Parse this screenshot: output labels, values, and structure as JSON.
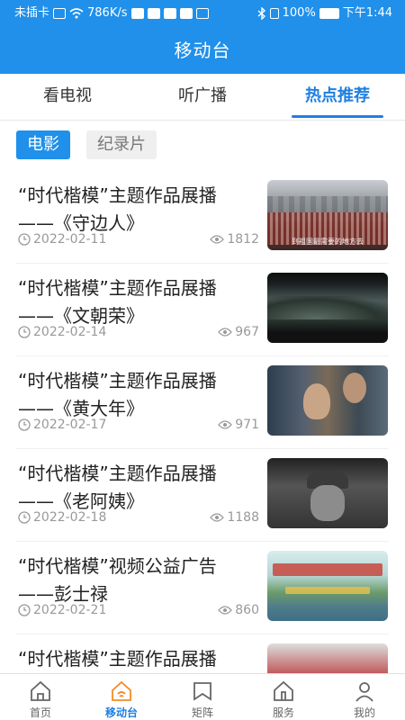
{
  "status_bar": {
    "carrier": "未插卡",
    "speed": "786K/s",
    "battery": "100%",
    "time": "下午1:44"
  },
  "app_title": "移动台",
  "tabs": [
    {
      "label": "看电视",
      "active": false
    },
    {
      "label": "听广播",
      "active": false
    },
    {
      "label": "热点推荐",
      "active": true
    }
  ],
  "chips": [
    {
      "label": "电影",
      "active": true
    },
    {
      "label": "纪录片",
      "active": false
    }
  ],
  "items": [
    {
      "title": "“时代楷模”主题作品展播——《守边人》",
      "date": "2022-02-11",
      "views": "1812",
      "thumb_caption": "到祖国最需要的地方去"
    },
    {
      "title": "“时代楷模”主题作品展播——《文朝荣》",
      "date": "2022-02-14",
      "views": "967",
      "thumb_caption": ""
    },
    {
      "title": "“时代楷模”主题作品展播——《黄大年》",
      "date": "2022-02-17",
      "views": "971",
      "thumb_caption": ""
    },
    {
      "title": "“时代楷模”主题作品展播——《老阿姨》",
      "date": "2022-02-18",
      "views": "1188",
      "thumb_caption": ""
    },
    {
      "title": "“时代楷模”视频公益广告——彭士禄",
      "date": "2022-02-21",
      "views": "860",
      "thumb_caption": ""
    },
    {
      "title": "“时代楷模”主题作品展播——《走近马卡克》",
      "date": "",
      "views": "",
      "thumb_caption": ""
    }
  ],
  "bottom_nav": [
    {
      "label": "首页",
      "icon": "home-icon",
      "active": false
    },
    {
      "label": "移动台",
      "icon": "broadcast-home-icon",
      "active": true
    },
    {
      "label": "矩阵",
      "icon": "bookmark-flag-icon",
      "active": false
    },
    {
      "label": "服务",
      "icon": "service-house-icon",
      "active": false
    },
    {
      "label": "我的",
      "icon": "person-icon",
      "active": false
    }
  ],
  "colors": {
    "accent": "#2090ea",
    "active_text": "#1f7fe0"
  }
}
